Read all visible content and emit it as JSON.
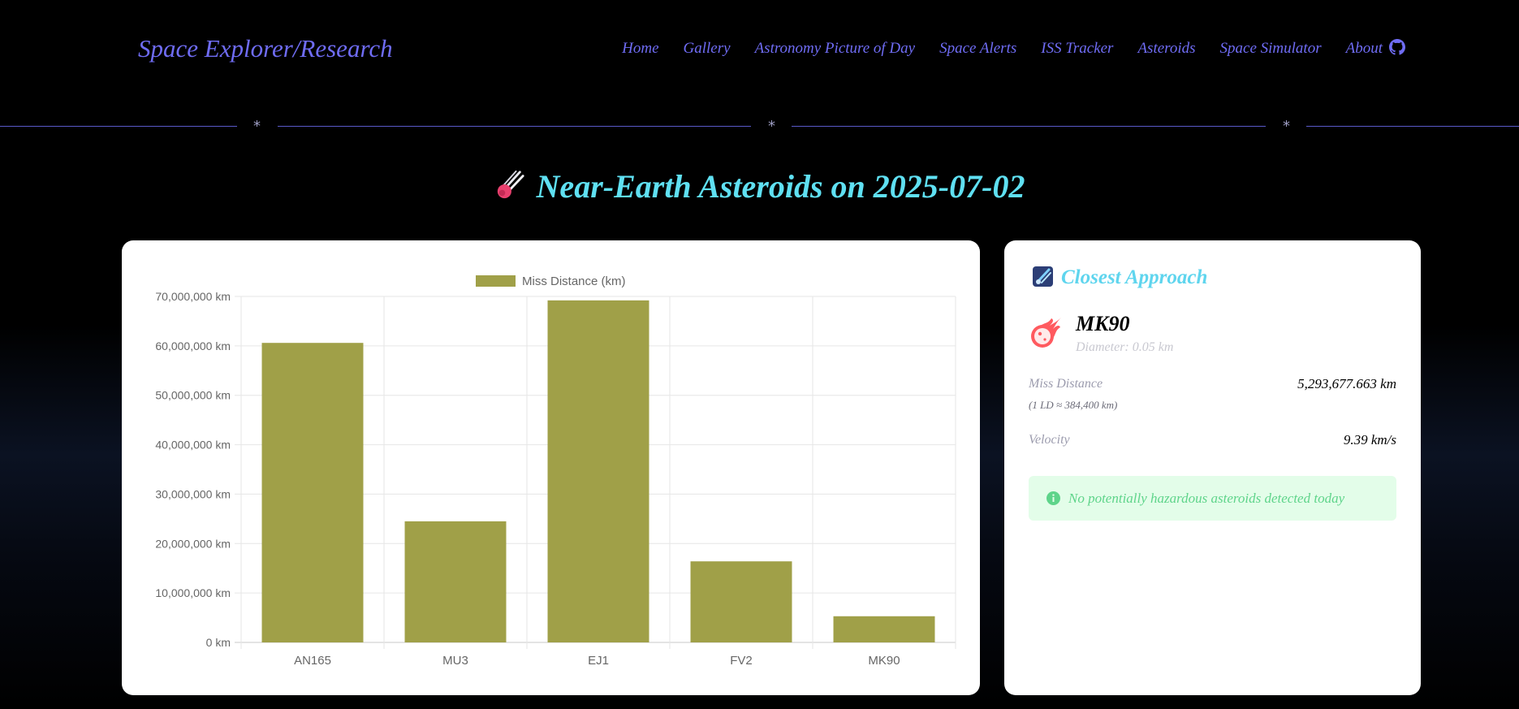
{
  "header": {
    "brand": "Space Explorer/Research",
    "nav": [
      "Home",
      "Gallery",
      "Astronomy Picture of Day",
      "Space Alerts",
      "ISS Tracker",
      "Asteroids",
      "Space Simulator",
      "About"
    ]
  },
  "divider": {
    "star": "*"
  },
  "page": {
    "title": "Near-Earth Asteroids on 2025-07-02"
  },
  "chart_data": {
    "type": "bar",
    "categories": [
      "AN165",
      "MU3",
      "EJ1",
      "FV2",
      "MK90"
    ],
    "series": [
      {
        "name": "Miss Distance (km)",
        "values": [
          60600000,
          24500000,
          69200000,
          16400000,
          5293677.663
        ]
      }
    ],
    "ylim": [
      0,
      70000000
    ],
    "yticks": [
      "0 km",
      "10,000,000 km",
      "20,000,000 km",
      "30,000,000 km",
      "40,000,000 km",
      "50,000,000 km",
      "60,000,000 km",
      "70,000,000 km"
    ],
    "bar_color": "#a0a048",
    "grid": true,
    "legend": "top"
  },
  "closest": {
    "title": "Closest Approach",
    "name": "MK90",
    "diameter": "Diameter: 0.05 km",
    "miss_label": "Miss Distance",
    "miss_value": "5,293,677.663 km",
    "ld_note": "(1 LD ≈ 384,400 km)",
    "velocity_label": "Velocity",
    "velocity_value": "9.39 km/s",
    "alert": "No potentially hazardous asteroids detected today"
  },
  "colors": {
    "nav": "#6f6cf4",
    "title": "#5fe0f2",
    "alert_bg": "#e3fde9",
    "alert_text": "#5ed48a"
  }
}
